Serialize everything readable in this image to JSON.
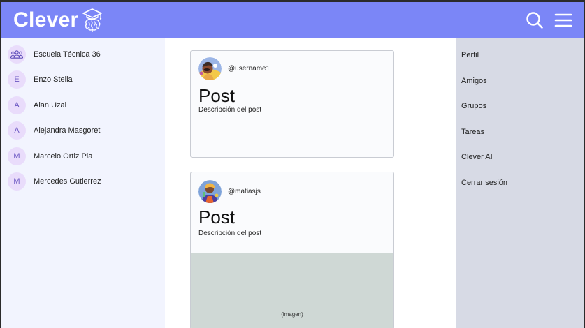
{
  "header": {
    "brand": "Clever",
    "icons": {
      "search": "search-icon",
      "menu": "hamburger-menu-icon",
      "logo": "brain-graduation-cap-icon"
    }
  },
  "colors": {
    "header_bg": "#7b86f7",
    "left_sidebar_bg": "#f2f4fe",
    "right_sidebar_bg": "#d7dae5",
    "avatar_bg": "#e9dcfb",
    "image_placeholder": "#cfd8d5"
  },
  "left_sidebar": {
    "items": [
      {
        "initial": "",
        "icon": "group-icon",
        "name": "Escuela Técnica 36"
      },
      {
        "initial": "E",
        "name": "Enzo Stella"
      },
      {
        "initial": "A",
        "name": "Alan Uzal"
      },
      {
        "initial": "A",
        "name": "Alejandra Masgoret"
      },
      {
        "initial": "M",
        "name": "Marcelo Ortiz Pla"
      },
      {
        "initial": "M",
        "name": "Mercedes Gutierrez"
      }
    ]
  },
  "feed": {
    "posts": [
      {
        "username": "@username1",
        "title": "Post",
        "description": "Descripción del post"
      },
      {
        "username": "@matiasjs",
        "title": "Post",
        "description": "Descripción del post",
        "image_label": "(imagen)"
      }
    ]
  },
  "right_sidebar": {
    "items": [
      {
        "label": "Perfil"
      },
      {
        "label": "Amigos"
      },
      {
        "label": "Grupos"
      },
      {
        "label": "Tareas"
      },
      {
        "label": "Clever AI"
      },
      {
        "label": "Cerrar sesión"
      }
    ]
  }
}
